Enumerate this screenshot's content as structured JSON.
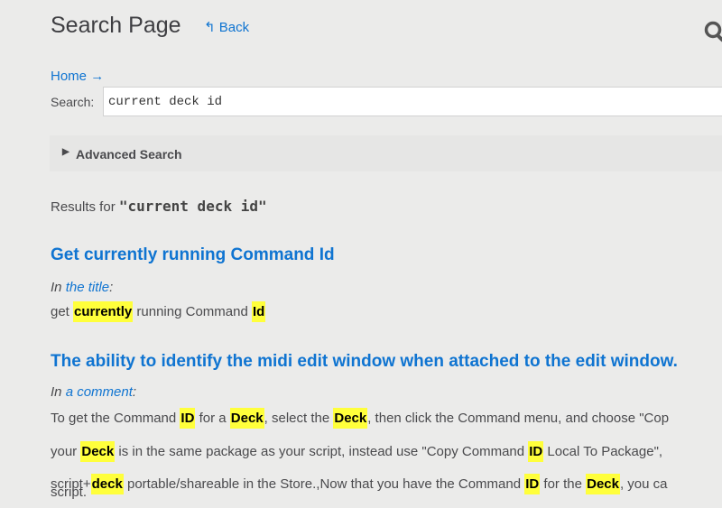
{
  "header": {
    "title": "Search Page",
    "back_label": "Back",
    "back_icon": "reply-arrow-icon",
    "search_icon": "magnifier-icon"
  },
  "breadcrumb": {
    "home_label": "Home",
    "arrow": "→"
  },
  "search": {
    "label": "Search:",
    "value": "current deck id"
  },
  "advanced": {
    "label": "Advanced Search"
  },
  "results_header": {
    "prefix": "Results for ",
    "query": "\"current deck id\""
  },
  "colors": {
    "link": "#0f74d1",
    "highlight": "#ffff3b",
    "background": "#ebebea"
  },
  "results": [
    {
      "title": "Get currently running Command Id",
      "where_prefix": "In ",
      "where_link": "the title",
      "where_suffix": ":",
      "lines": [
        [
          {
            "t": "get "
          },
          {
            "t": "currently",
            "h": true
          },
          {
            "t": " running Command "
          },
          {
            "t": "Id",
            "h": true
          }
        ]
      ]
    },
    {
      "title": "The ability to identify the midi edit window when attached to the edit window.",
      "where_prefix": "In ",
      "where_link": "a comment",
      "where_suffix": ":",
      "lines": [
        [
          {
            "t": "To get the Command "
          },
          {
            "t": "ID",
            "h": true
          },
          {
            "t": " for a "
          },
          {
            "t": "Deck",
            "h": true
          },
          {
            "t": ", select the "
          },
          {
            "t": "Deck",
            "h": true
          },
          {
            "t": ", then click the Command menu, and choose \"Cop"
          }
        ],
        [
          {
            "t": "your "
          },
          {
            "t": "Deck",
            "h": true
          },
          {
            "t": " is in the same package as your script, instead use \"Copy Command "
          },
          {
            "t": "ID",
            "h": true
          },
          {
            "t": " Local To Package\","
          }
        ],
        [
          {
            "t": "script+"
          },
          {
            "t": "deck",
            "h": true
          },
          {
            "t": " portable/shareable in the Store.,Now that you have the Command "
          },
          {
            "t": "ID",
            "h": true
          },
          {
            "t": " for the "
          },
          {
            "t": "Deck",
            "h": true
          },
          {
            "t": ", you ca"
          }
        ],
        [
          {
            "t": "script."
          }
        ]
      ]
    }
  ]
}
